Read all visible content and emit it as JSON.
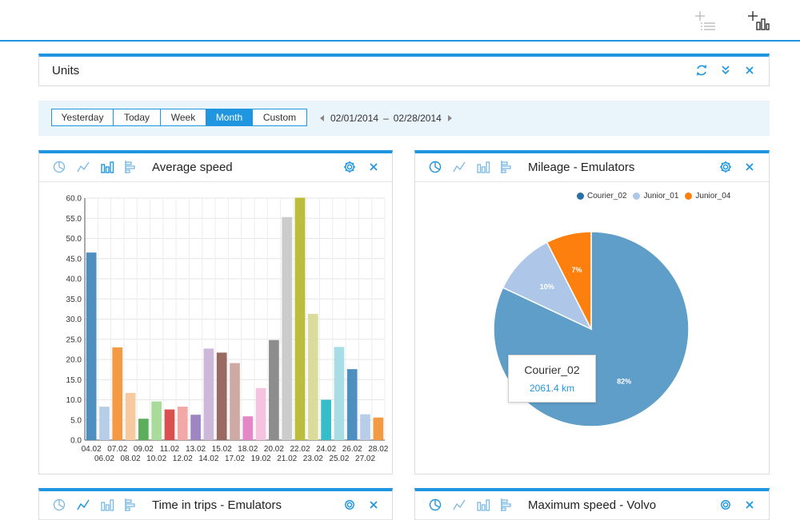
{
  "toolbar": {
    "add_unit_icon": "add-list-icon",
    "add_chart_icon": "add-chart-icon"
  },
  "units_panel": {
    "title": "Units"
  },
  "date_filter": {
    "buttons": [
      "Yesterday",
      "Today",
      "Week",
      "Month",
      "Custom"
    ],
    "active": "Month",
    "range_start": "02/01/2014",
    "range_sep": "–",
    "range_end": "02/28/2014"
  },
  "panels": {
    "speed": {
      "title": "Average speed"
    },
    "mileage": {
      "title": "Mileage - Emulators"
    },
    "trips": {
      "title": "Time in trips - Emulators"
    },
    "maxspeed": {
      "title": "Maximum speed - Volvo"
    }
  },
  "colors": {
    "accent": "#2196e0"
  },
  "chart_data": [
    {
      "type": "bar",
      "title": "Average speed",
      "ylim": [
        0,
        60
      ],
      "yticks": [
        "0.0",
        "5.0",
        "10.0",
        "15.0",
        "20.0",
        "25.0",
        "30.0",
        "35.0",
        "40.0",
        "45.0",
        "50.0",
        "55.0",
        "60.0"
      ],
      "grid": true,
      "categories": [
        "04.02",
        "06.02",
        "07.02",
        "08.02",
        "09.02",
        "10.02",
        "11.02",
        "12.02",
        "13.02",
        "14.02",
        "15.02",
        "17.02",
        "18.02",
        "19.02",
        "20.02",
        "21.02",
        "22.02",
        "23.02",
        "24.02",
        "25.02",
        "26.02",
        "27.02",
        "28.02"
      ],
      "values": [
        46.5,
        8.3,
        23.0,
        11.7,
        5.3,
        9.6,
        7.6,
        8.3,
        6.3,
        22.7,
        21.7,
        19.1,
        5.9,
        12.9,
        24.8,
        55.3,
        60.1,
        31.3,
        10.0,
        23.1,
        17.6,
        6.4,
        5.6
      ],
      "bar_colors": [
        "#4f8fc0",
        "#b8cde8",
        "#f49a45",
        "#f7c99f",
        "#5cad5c",
        "#a9dc9b",
        "#d9504f",
        "#f2a8a7",
        "#9e85c4",
        "#cdb8da",
        "#996a62",
        "#cfa9a3",
        "#e586c6",
        "#f5c2df",
        "#8d8d8d",
        "#cccccc",
        "#bcbd3c",
        "#dbdc9c",
        "#37bdc9",
        "#a8dde6",
        "#4f8fc0",
        "#b8cde8",
        "#f49a45"
      ]
    },
    {
      "type": "pie",
      "title": "Mileage - Emulators",
      "legend_position": "top",
      "series": [
        {
          "name": "Courier_02",
          "value": 82,
          "label": "82%",
          "color": "#5f9ec9",
          "legend_color": "#2a6fa8"
        },
        {
          "name": "Junior_01",
          "value": 10.5,
          "label": "10%",
          "color": "#aec7e8",
          "legend_color": "#aec7e8"
        },
        {
          "name": "Junior_04",
          "value": 7.5,
          "label": "7%",
          "color": "#fd7f0e",
          "legend_color": "#fd7f0e"
        }
      ],
      "tooltip": {
        "name": "Courier_02",
        "value": "2061.4 km"
      }
    }
  ]
}
